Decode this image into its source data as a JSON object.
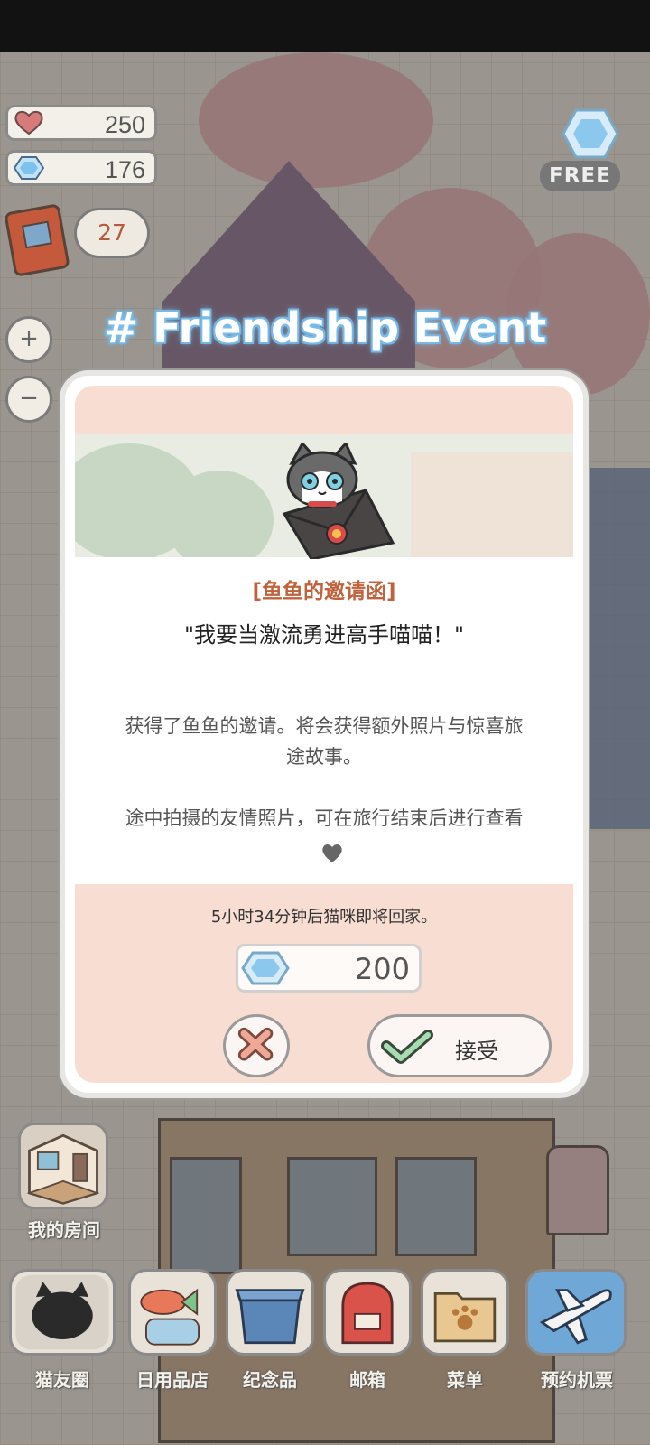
{
  "hud": {
    "hearts": "250",
    "gems": "176",
    "messages": "27",
    "free_label": "FREE",
    "zoom_in": "+",
    "zoom_out": "−"
  },
  "event_title": "# Friendship Event",
  "dialog": {
    "invite_title": "[鱼鱼的邀请函]",
    "quote": "\"我要当激流勇进高手喵喵！\"",
    "desc1_line1": "获得了鱼鱼的邀请。将会获得额外照片与惊喜旅",
    "desc1_line2": "途故事。",
    "desc2": "途中拍摄的友情照片，可在旅行结束后进行查看",
    "return_text": "5小时34分钟后猫咪即将回家。",
    "cost": "200",
    "accept_label": "接受"
  },
  "room_label": "我的房间",
  "nav": [
    {
      "label": "猫友圈"
    },
    {
      "label": "日用品店"
    },
    {
      "label": "纪念品"
    },
    {
      "label": "邮箱"
    },
    {
      "label": "菜单"
    },
    {
      "label": "预约机票"
    }
  ],
  "colors": {
    "accent_orange": "#c0623b",
    "dialog_pink": "#f7ddd2",
    "gem_blue": "#7fc1ee",
    "check_green": "#7bbf8a",
    "cancel_red": "#e89a88"
  }
}
